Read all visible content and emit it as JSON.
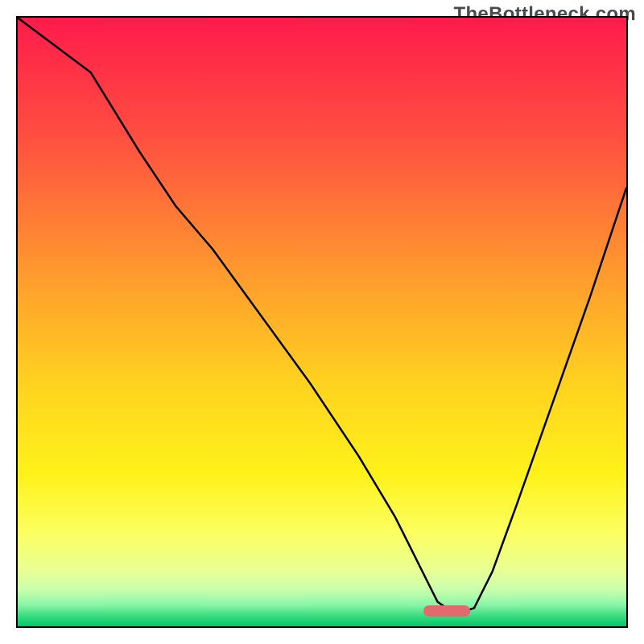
{
  "watermark": "TheBottleneck.com",
  "chart_data": {
    "type": "line",
    "title": "",
    "xlabel": "",
    "ylabel": "",
    "xlim": [
      0,
      100
    ],
    "ylim": [
      0,
      100
    ],
    "grid": false,
    "legend": false,
    "minimum_marker": {
      "x": 70.5,
      "y": 2.5
    },
    "gradient_stops": [
      {
        "offset": 0.0,
        "color": "#ff1b4b"
      },
      {
        "offset": 0.2,
        "color": "#ff5040"
      },
      {
        "offset": 0.42,
        "color": "#ff9a2e"
      },
      {
        "offset": 0.6,
        "color": "#ffd21f"
      },
      {
        "offset": 0.75,
        "color": "#fff21a"
      },
      {
        "offset": 0.85,
        "color": "#fbff63"
      },
      {
        "offset": 0.91,
        "color": "#e7ff96"
      },
      {
        "offset": 0.94,
        "color": "#c9ffae"
      },
      {
        "offset": 0.965,
        "color": "#88f5a7"
      },
      {
        "offset": 0.985,
        "color": "#31d97b"
      },
      {
        "offset": 1.0,
        "color": "#00c86a"
      }
    ],
    "series": [
      {
        "name": "bottleneck-curve",
        "x": [
          0,
          12,
          20,
          26,
          32,
          40,
          48,
          56,
          62,
          66,
          69,
          72,
          75,
          78,
          82,
          88,
          94,
          100
        ],
        "values": [
          100,
          91,
          78,
          69,
          62,
          51,
          40,
          28,
          18,
          10,
          4,
          2,
          3,
          9,
          20,
          37,
          54,
          72
        ]
      }
    ]
  }
}
